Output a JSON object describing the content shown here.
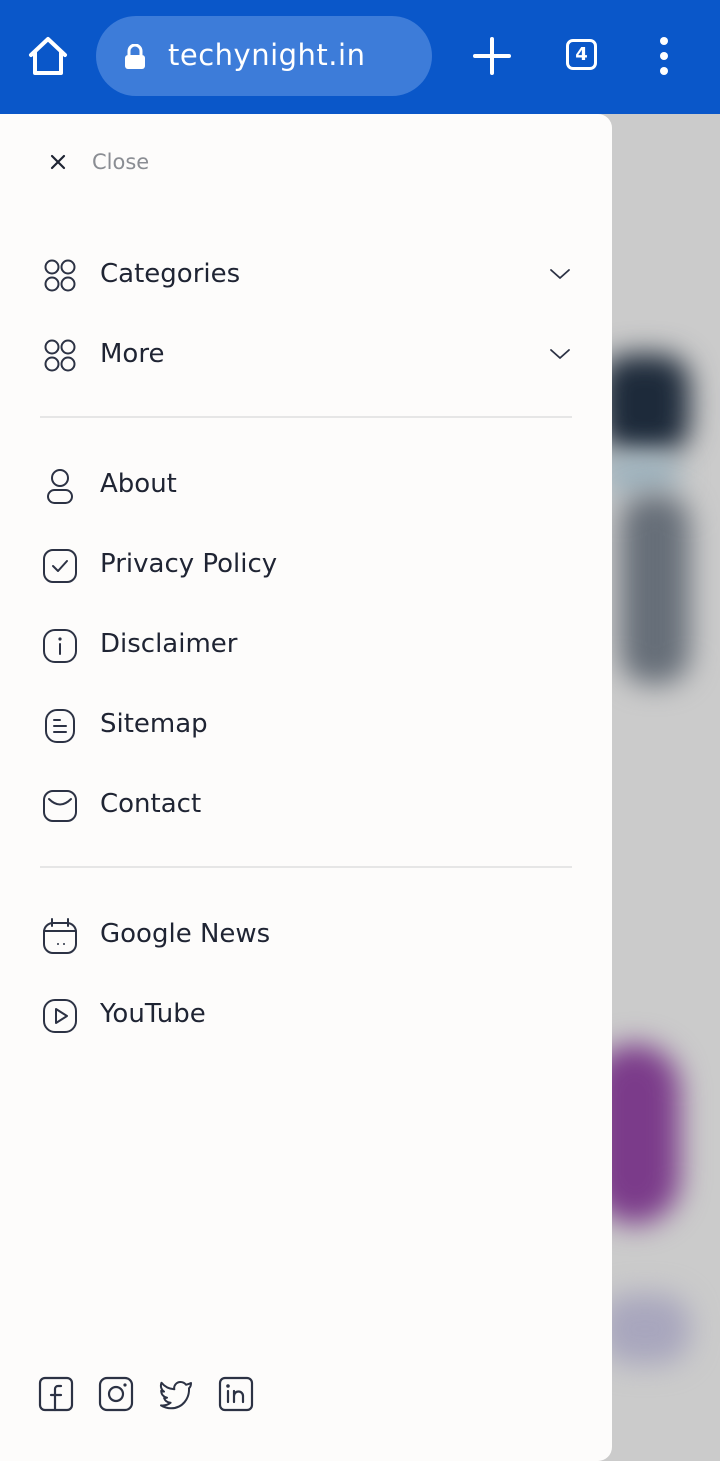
{
  "browser": {
    "url": "techynight.in",
    "tab_count": "4",
    "bar_color": "#0a57c9",
    "url_pill_color": "#3d7cd9"
  },
  "drawer": {
    "close_label": "Close",
    "menu_groups": [
      {
        "label": "Categories",
        "icon": "grid-icon",
        "expandable": true
      },
      {
        "label": "More",
        "icon": "grid-icon",
        "expandable": true
      }
    ],
    "pages": [
      {
        "label": "About",
        "icon": "user-icon"
      },
      {
        "label": "Privacy Policy",
        "icon": "shield-check-icon"
      },
      {
        "label": "Disclaimer",
        "icon": "info-icon"
      },
      {
        "label": "Sitemap",
        "icon": "document-icon"
      },
      {
        "label": "Contact",
        "icon": "mail-icon"
      }
    ],
    "links": [
      {
        "label": "Google News",
        "icon": "calendar-icon"
      },
      {
        "label": "YouTube",
        "icon": "play-icon"
      }
    ],
    "social": [
      "facebook-icon",
      "instagram-icon",
      "twitter-icon",
      "linkedin-icon"
    ]
  }
}
